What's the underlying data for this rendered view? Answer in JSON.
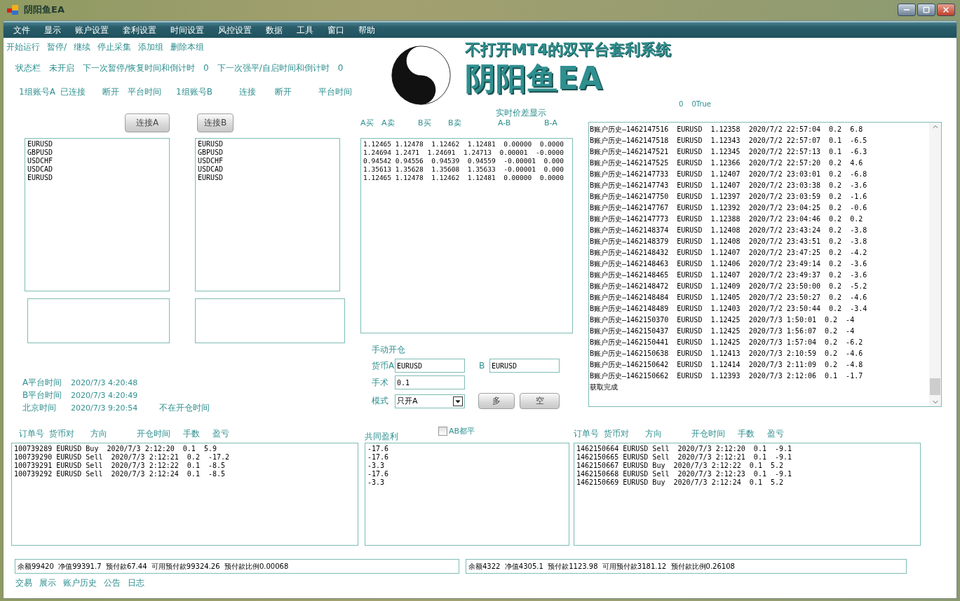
{
  "window": {
    "title": "阴阳鱼EA"
  },
  "menu": [
    "文件",
    "显示",
    "账户设置",
    "套利设置",
    "时间设置",
    "风控设置",
    "数据",
    "工具",
    "窗口",
    "帮助"
  ],
  "commands": [
    "开始运行",
    "暂停/",
    "继续",
    "停止采集",
    "添加组",
    "删除本组"
  ],
  "status_bar": [
    "状态栏",
    "未开启",
    "下一次暂停/恢复时间和倒计时",
    "0",
    "下一次强平/自启时间和倒计时",
    "0"
  ],
  "accounts_row": [
    "1组账号A",
    "已连接",
    "断开",
    "平台时间",
    "1组账号B",
    "连接",
    "断开",
    "平台时间"
  ],
  "logo": {
    "tagline": "不打开MT4的双平台套利系统",
    "title": "阴阳鱼EA"
  },
  "symbol_groups": [
    {
      "button": "连接A",
      "symbols": [
        "EURUSD",
        "GBPUSD",
        "USDCHF",
        "USDCAD",
        "EURUSD"
      ]
    },
    {
      "button": "连接B",
      "symbols": [
        "EURUSD",
        "GBPUSD",
        "USDCHF",
        "USDCAD",
        "EURUSD"
      ]
    }
  ],
  "platform_times": [
    {
      "label": "A平台时间",
      "value": "2020/7/3 4:20:48"
    },
    {
      "label": "B平台时间",
      "value": "2020/7/3 4:20:49"
    },
    {
      "label": "北京时间",
      "value": "2020/7/3 9:20:54",
      "note": "不在开仓时间"
    }
  ],
  "spread_panel": {
    "title": "实时价差显示",
    "columns": [
      "A买",
      "A卖",
      "B买",
      "B卖",
      "A-B",
      "B-A"
    ],
    "rows": [
      "1.12465 1.12478  1.12462  1.12481  0.00000  0.0000",
      "1.24694 1.2471  1.24691  1.24713  0.00001  -0.0000",
      "0.94542 0.94556  0.94539  0.94559  -0.00001  0.000",
      "1.35613 1.35628  1.35608  1.35633  -0.00001  0.000",
      "1.12465 1.12478  1.12462  1.12481  0.00000  0.0000"
    ]
  },
  "manual_open": {
    "title": "手动开仓",
    "currency_a": {
      "label": "货币A",
      "value": "EURUSD"
    },
    "currency_b": {
      "label": "B",
      "value": "EURUSD"
    },
    "lots": {
      "label": "手术",
      "value": "0.1"
    },
    "mode": {
      "label": "模式",
      "value": "只开A"
    },
    "buttons": [
      "多",
      "空"
    ]
  },
  "counters": [
    "0",
    "0True"
  ],
  "history_log": [
    "B账户历史—1462147516  EURUSD  1.12358  2020/7/2 22:57:04  0.2  6.8",
    "B账户历史—1462147518  EURUSD  1.12343  2020/7/2 22:57:07  0.1  -6.5",
    "B账户历史—1462147521  EURUSD  1.12345  2020/7/2 22:57:13  0.1  -6.3",
    "B账户历史—1462147525  EURUSD  1.12366  2020/7/2 22:57:20  0.2  4.6",
    "B账户历史—1462147733  EURUSD  1.12407  2020/7/2 23:03:01  0.2  -6.8",
    "B账户历史—1462147743  EURUSD  1.12407  2020/7/2 23:03:38  0.2  -3.6",
    "B账户历史—1462147750  EURUSD  1.12397  2020/7/2 23:03:59  0.2  -1.6",
    "B账户历史—1462147767  EURUSD  1.12392  2020/7/2 23:04:25  0.2  -0.6",
    "B账户历史—1462147773  EURUSD  1.12388  2020/7/2 23:04:46  0.2  0.2",
    "B账户历史—1462148374  EURUSD  1.12408  2020/7/2 23:43:24  0.2  -3.8",
    "B账户历史—1462148379  EURUSD  1.12408  2020/7/2 23:43:51  0.2  -3.8",
    "B账户历史—1462148432  EURUSD  1.12407  2020/7/2 23:47:25  0.2  -4.2",
    "B账户历史—1462148463  EURUSD  1.12406  2020/7/2 23:49:14  0.2  -3.6",
    "B账户历史—1462148465  EURUSD  1.12407  2020/7/2 23:49:37  0.2  -3.6",
    "B账户历史—1462148472  EURUSD  1.12409  2020/7/2 23:50:00  0.2  -5.2",
    "B账户历史—1462148484  EURUSD  1.12405  2020/7/2 23:50:27  0.2  -4.6",
    "B账户历史—1462148489  EURUSD  1.12403  2020/7/2 23:50:44  0.2  -3.4",
    "B账户历史—1462150370  EURUSD  1.12425  2020/7/3 1:50:01  0.2  -4",
    "B账户历史—1462150437  EURUSD  1.12425  2020/7/3 1:56:07  0.2  -4",
    "B账户历史—1462150441  EURUSD  1.12425  2020/7/3 1:57:04  0.2  -6.2",
    "B账户历史—1462150638  EURUSD  1.12413  2020/7/3 2:10:59  0.2  -4.6",
    "B账户历史—1462150642  EURUSD  1.12414  2020/7/3 2:11:09  0.2  -4.8",
    "B账户历史—1462150662  EURUSD  1.12393  2020/7/3 2:12:06  0.1  -1.7",
    "获取完成"
  ],
  "orders_a": {
    "columns": [
      "订单号",
      "货币对",
      "方向",
      "开仓时间",
      "手数",
      "盈亏"
    ],
    "rows": [
      "100739289 EURUSD Buy  2020/7/3 2:12:20  0.1  5.9",
      "100739290 EURUSD Sell  2020/7/3 2:12:21  0.2  -17.2",
      "100739291 EURUSD Sell  2020/7/3 2:12:22  0.1  -8.5",
      "100739292 EURUSD Sell  2020/7/3 2:12:24  0.1  -8.5"
    ]
  },
  "common_profit": {
    "title": "共同盈利",
    "close_both": {
      "label": "AB都平",
      "checked": false
    },
    "values": [
      "-17.6",
      "-17.6",
      "-3.3",
      "-17.6",
      "-3.3"
    ]
  },
  "orders_b": {
    "columns": [
      "订单号",
      "货币对",
      "方向",
      "开仓时间",
      "手数",
      "盈亏"
    ],
    "rows": [
      "1462150664 EURUSD Sell  2020/7/3 2:12:20  0.1  -9.1",
      "1462150665 EURUSD Sell  2020/7/3 2:12:21  0.1  -9.1",
      "1462150667 EURUSD Buy  2020/7/3 2:12:22  0.1  5.2",
      "1462150668 EURUSD Sell  2020/7/3 2:12:23  0.1  -9.1",
      "1462150669 EURUSD Buy  2020/7/3 2:12:24  0.1  5.2"
    ]
  },
  "balances": [
    "余额99420  净值99391.7  预付款67.44  可用预付款99324.26  预付款比例0.00068",
    "余额4322  净值4305.1  预付款1123.98  可用预付款3181.12  预付款比例0.26108"
  ],
  "bottom_tabs": [
    "交易",
    "展示",
    "账户历史",
    "公告",
    "日志"
  ]
}
